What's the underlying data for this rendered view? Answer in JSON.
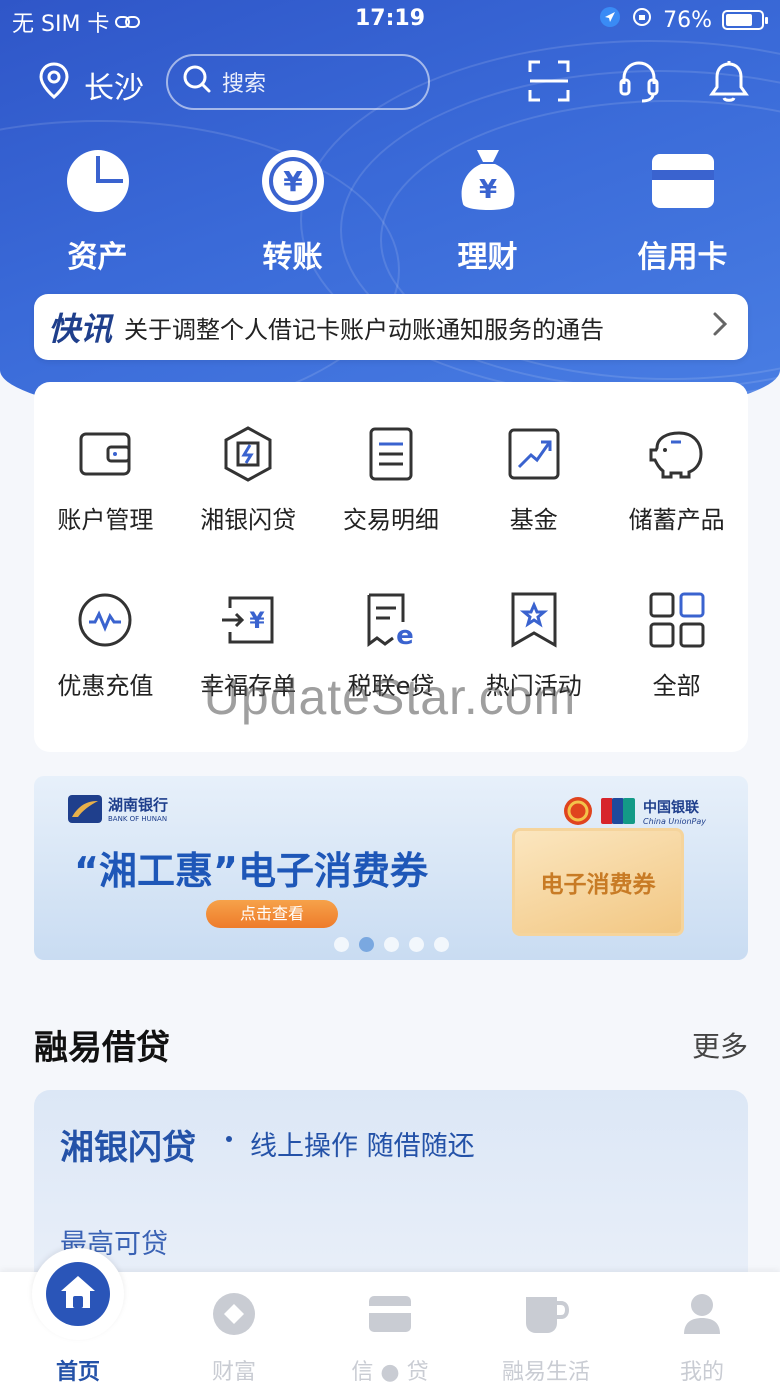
{
  "status_bar": {
    "carrier": "无 SIM 卡",
    "time": "17:19",
    "battery": "76%",
    "battery_level": 0.76
  },
  "header": {
    "city": "长沙",
    "search_placeholder": "搜索"
  },
  "quick_actions": [
    {
      "label": "资产",
      "icon": "pie-chart-icon"
    },
    {
      "label": "转账",
      "icon": "yuan-transfer-icon"
    },
    {
      "label": "理财",
      "icon": "money-bag-icon"
    },
    {
      "label": "信用卡",
      "icon": "credit-card-icon"
    }
  ],
  "news": {
    "tag": "快讯",
    "text": "关于调整个人借记卡账户动账通知服务的通告"
  },
  "services": [
    {
      "label": "账户管理",
      "icon": "wallet-icon"
    },
    {
      "label": "湘银闪贷",
      "icon": "lightning-shield-icon"
    },
    {
      "label": "交易明细",
      "icon": "document-list-icon"
    },
    {
      "label": "基金",
      "icon": "trend-up-icon"
    },
    {
      "label": "储蓄产品",
      "icon": "piggy-bank-icon"
    },
    {
      "label": "优惠充值",
      "icon": "pulse-icon"
    },
    {
      "label": "幸福存单",
      "icon": "deposit-icon"
    },
    {
      "label": "税联e贷",
      "icon": "tax-e-loan-icon"
    },
    {
      "label": "热门活动",
      "icon": "star-badge-icon"
    },
    {
      "label": "全部",
      "icon": "grid-icon"
    }
  ],
  "watermark": "UpdateStar.com",
  "banner": {
    "bank_name": "湖南银行",
    "bank_name_en": "BANK OF HUNAN",
    "unionpay_name": "中国银联",
    "unionpay_en": "China UnionPay",
    "title": "“湘工惠”电子消费券",
    "button": "点击查看",
    "coupon_text": "电子消费券"
  },
  "section": {
    "title": "融易借贷",
    "more": "更多"
  },
  "loan_card": {
    "name": "湘银闪贷",
    "slogan": "线上操作 随借随还",
    "max_label": "最高可贷"
  },
  "tabs": [
    {
      "label": "首页",
      "icon": "home-icon",
      "active": true
    },
    {
      "label": "财富",
      "icon": "wealth-icon",
      "active": false
    },
    {
      "label": "信 ● 贷",
      "icon": "card-icon",
      "active": false
    },
    {
      "label": "融易生活",
      "icon": "cup-icon",
      "active": false
    },
    {
      "label": "我的",
      "icon": "user-icon",
      "active": false
    }
  ],
  "colors": {
    "primary": "#2f56c8",
    "accent_text": "#2452a8",
    "tab_inactive": "#c9ccd3"
  }
}
